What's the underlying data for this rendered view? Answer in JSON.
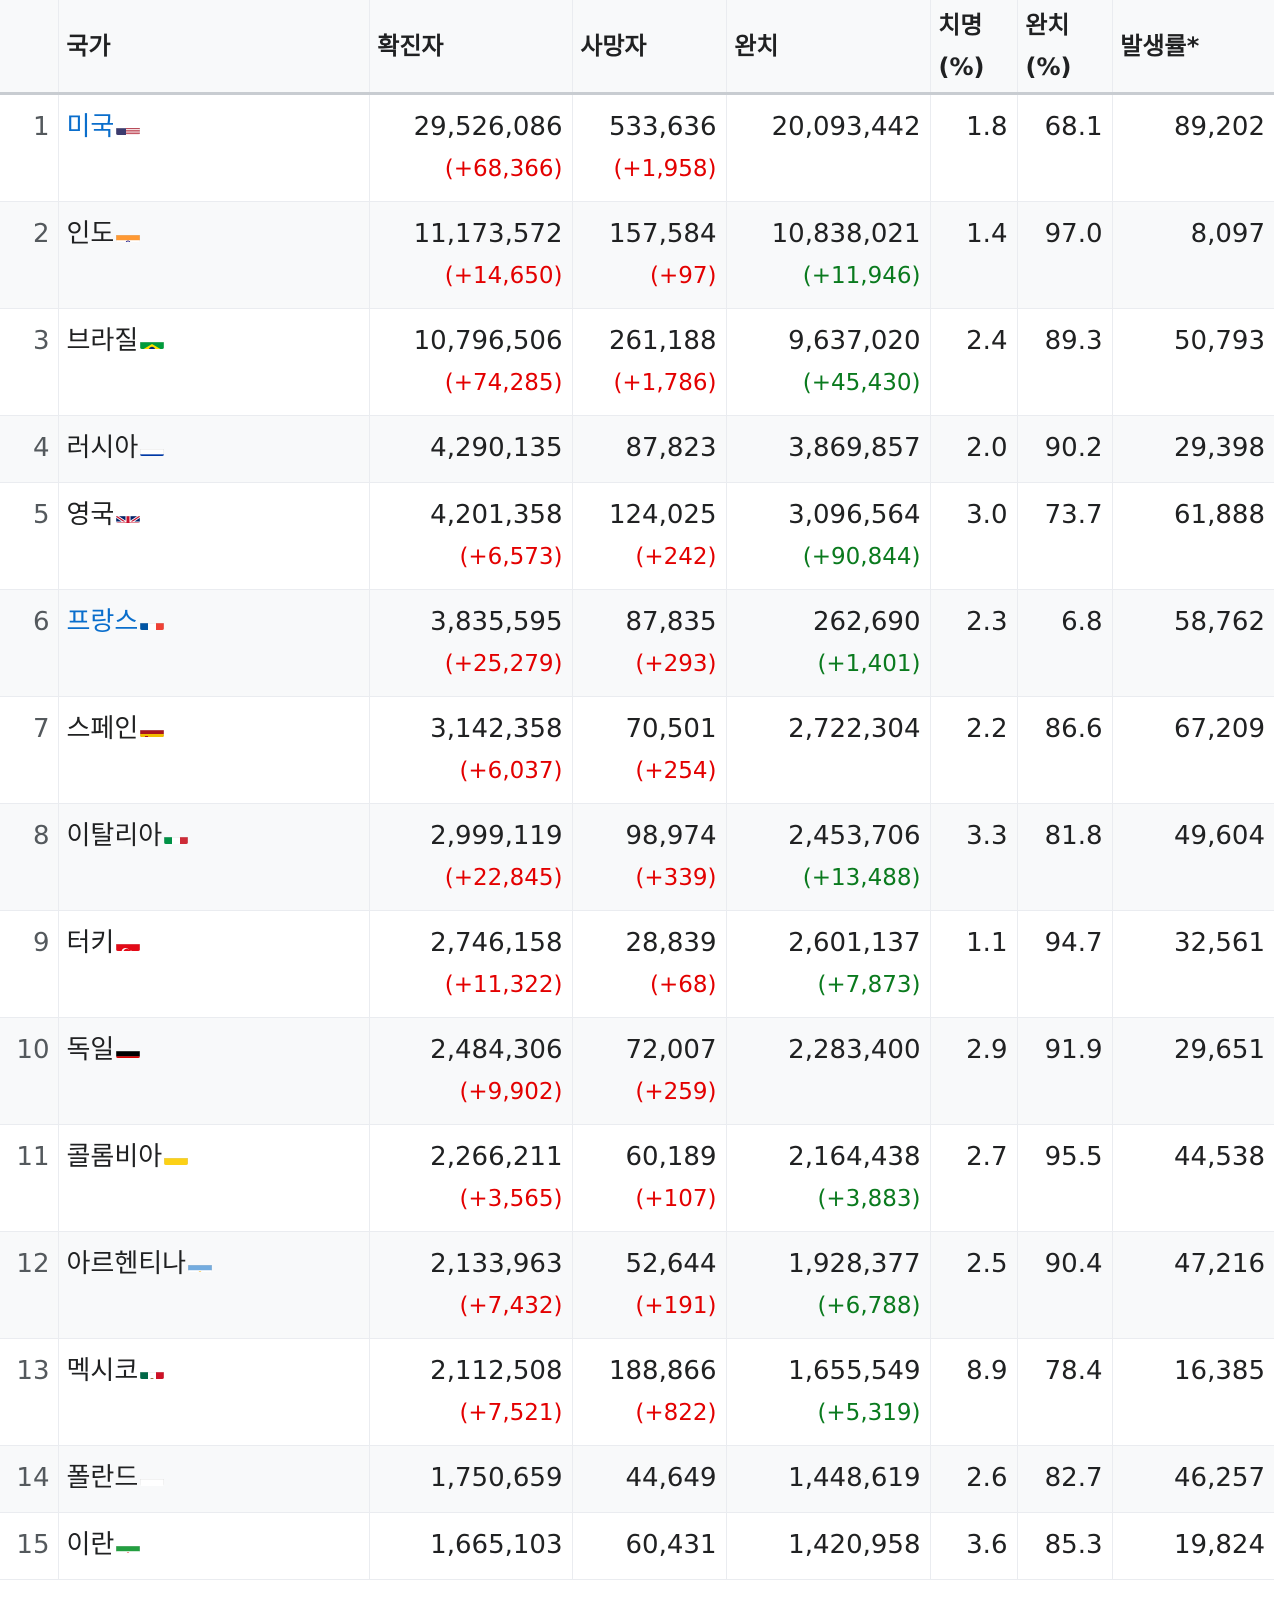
{
  "header": {
    "rank": "",
    "country": "국가",
    "confirmed": "확진자",
    "deaths": "사망자",
    "recovered": "완치",
    "fatality_line1": "치명",
    "fatality_line2": "(%)",
    "recovery_line1": "완치",
    "recovery_line2": "(%)",
    "incidence": "발생률*"
  },
  "colors": {
    "link": "#0a6ecc",
    "increase_red": "#e30000",
    "increase_green": "#0a7a1e"
  },
  "rows": [
    {
      "rank": "1",
      "name": "미국",
      "link": true,
      "flag": "us-flag",
      "confirmed": "29,526,086",
      "confirmed_delta": "(+68,366)",
      "deaths": "533,636",
      "deaths_delta": "(+1,958)",
      "recovered": "20,093,442",
      "recovered_delta": "",
      "fatality": "1.8",
      "recovery": "68.1",
      "incidence": "89,202"
    },
    {
      "rank": "2",
      "name": "인도",
      "link": false,
      "flag": "in-flag",
      "confirmed": "11,173,572",
      "confirmed_delta": "(+14,650)",
      "deaths": "157,584",
      "deaths_delta": "(+97)",
      "recovered": "10,838,021",
      "recovered_delta": "(+11,946)",
      "fatality": "1.4",
      "recovery": "97.0",
      "incidence": "8,097"
    },
    {
      "rank": "3",
      "name": "브라질",
      "link": false,
      "flag": "br-flag",
      "confirmed": "10,796,506",
      "confirmed_delta": "(+74,285)",
      "deaths": "261,188",
      "deaths_delta": "(+1,786)",
      "recovered": "9,637,020",
      "recovered_delta": "(+45,430)",
      "fatality": "2.4",
      "recovery": "89.3",
      "incidence": "50,793"
    },
    {
      "rank": "4",
      "name": "러시아",
      "link": false,
      "flag": "ru-flag",
      "confirmed": "4,290,135",
      "confirmed_delta": "",
      "deaths": "87,823",
      "deaths_delta": "",
      "recovered": "3,869,857",
      "recovered_delta": "",
      "fatality": "2.0",
      "recovery": "90.2",
      "incidence": "29,398"
    },
    {
      "rank": "5",
      "name": "영국",
      "link": false,
      "flag": "gb-flag",
      "confirmed": "4,201,358",
      "confirmed_delta": "(+6,573)",
      "deaths": "124,025",
      "deaths_delta": "(+242)",
      "recovered": "3,096,564",
      "recovered_delta": "(+90,844)",
      "fatality": "3.0",
      "recovery": "73.7",
      "incidence": "61,888"
    },
    {
      "rank": "6",
      "name": "프랑스",
      "link": true,
      "flag": "fr-flag",
      "confirmed": "3,835,595",
      "confirmed_delta": "(+25,279)",
      "deaths": "87,835",
      "deaths_delta": "(+293)",
      "recovered": "262,690",
      "recovered_delta": "(+1,401)",
      "fatality": "2.3",
      "recovery": "6.8",
      "incidence": "58,762"
    },
    {
      "rank": "7",
      "name": "스페인",
      "link": false,
      "flag": "es-flag",
      "confirmed": "3,142,358",
      "confirmed_delta": "(+6,037)",
      "deaths": "70,501",
      "deaths_delta": "(+254)",
      "recovered": "2,722,304",
      "recovered_delta": "",
      "fatality": "2.2",
      "recovery": "86.6",
      "incidence": "67,209"
    },
    {
      "rank": "8",
      "name": "이탈리아",
      "link": false,
      "flag": "it-flag",
      "confirmed": "2,999,119",
      "confirmed_delta": "(+22,845)",
      "deaths": "98,974",
      "deaths_delta": "(+339)",
      "recovered": "2,453,706",
      "recovered_delta": "(+13,488)",
      "fatality": "3.3",
      "recovery": "81.8",
      "incidence": "49,604"
    },
    {
      "rank": "9",
      "name": "터키",
      "link": false,
      "flag": "tr-flag",
      "confirmed": "2,746,158",
      "confirmed_delta": "(+11,322)",
      "deaths": "28,839",
      "deaths_delta": "(+68)",
      "recovered": "2,601,137",
      "recovered_delta": "(+7,873)",
      "fatality": "1.1",
      "recovery": "94.7",
      "incidence": "32,561"
    },
    {
      "rank": "10",
      "name": "독일",
      "link": false,
      "flag": "de-flag",
      "confirmed": "2,484,306",
      "confirmed_delta": "(+9,902)",
      "deaths": "72,007",
      "deaths_delta": "(+259)",
      "recovered": "2,283,400",
      "recovered_delta": "",
      "fatality": "2.9",
      "recovery": "91.9",
      "incidence": "29,651"
    },
    {
      "rank": "11",
      "name": "콜롬비아",
      "link": false,
      "flag": "co-flag",
      "confirmed": "2,266,211",
      "confirmed_delta": "(+3,565)",
      "deaths": "60,189",
      "deaths_delta": "(+107)",
      "recovered": "2,164,438",
      "recovered_delta": "(+3,883)",
      "fatality": "2.7",
      "recovery": "95.5",
      "incidence": "44,538"
    },
    {
      "rank": "12",
      "name": "아르헨티나",
      "link": false,
      "flag": "ar-flag",
      "confirmed": "2,133,963",
      "confirmed_delta": "(+7,432)",
      "deaths": "52,644",
      "deaths_delta": "(+191)",
      "recovered": "1,928,377",
      "recovered_delta": "(+6,788)",
      "fatality": "2.5",
      "recovery": "90.4",
      "incidence": "47,216"
    },
    {
      "rank": "13",
      "name": "멕시코",
      "link": false,
      "flag": "mx-flag",
      "confirmed": "2,112,508",
      "confirmed_delta": "(+7,521)",
      "deaths": "188,866",
      "deaths_delta": "(+822)",
      "recovered": "1,655,549",
      "recovered_delta": "(+5,319)",
      "fatality": "8.9",
      "recovery": "78.4",
      "incidence": "16,385"
    },
    {
      "rank": "14",
      "name": "폴란드",
      "link": false,
      "flag": "pl-flag",
      "confirmed": "1,750,659",
      "confirmed_delta": "",
      "deaths": "44,649",
      "deaths_delta": "",
      "recovered": "1,448,619",
      "recovered_delta": "",
      "fatality": "2.6",
      "recovery": "82.7",
      "incidence": "46,257"
    },
    {
      "rank": "15",
      "name": "이란",
      "link": false,
      "flag": "ir-flag",
      "confirmed": "1,665,103",
      "confirmed_delta": "",
      "deaths": "60,431",
      "deaths_delta": "",
      "recovered": "1,420,958",
      "recovered_delta": "",
      "fatality": "3.6",
      "recovery": "85.3",
      "incidence": "19,824"
    }
  ]
}
